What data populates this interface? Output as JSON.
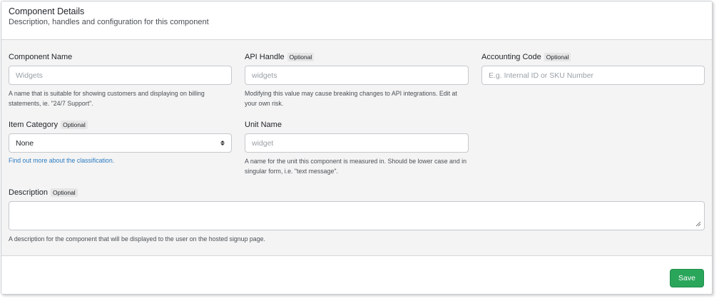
{
  "header": {
    "title": "Component Details",
    "subtitle": "Description, handles and configuration for this component"
  },
  "fields": {
    "component_name": {
      "label": "Component Name",
      "placeholder": "Widgets",
      "help": "A name that is suitable for showing customers and displaying on billing statements, ie. \"24/7 Support\"."
    },
    "api_handle": {
      "label": "API Handle",
      "badge": "Optional",
      "placeholder": "widgets",
      "help": "Modifying this value may cause breaking changes to API integrations. Edit at your own risk."
    },
    "accounting_code": {
      "label": "Accounting Code",
      "badge": "Optional",
      "placeholder": "E.g. Internal ID or SKU Number"
    },
    "item_category": {
      "label": "Item Category",
      "badge": "Optional",
      "value": "None",
      "link": "Find out more about the classification."
    },
    "unit_name": {
      "label": "Unit Name",
      "placeholder": "widget",
      "help": "A name for the unit this component is measured in. Should be lower case and in singular form, i.e. \"text message\"."
    },
    "description": {
      "label": "Description",
      "badge": "Optional",
      "help": "A description for the component that will be displayed to the user on the hosted signup page."
    }
  },
  "footer": {
    "save_label": "Save"
  },
  "colors": {
    "save_button": "#2aa65b",
    "link": "#2b7bc0",
    "body_bg": "#f4f4f4"
  }
}
